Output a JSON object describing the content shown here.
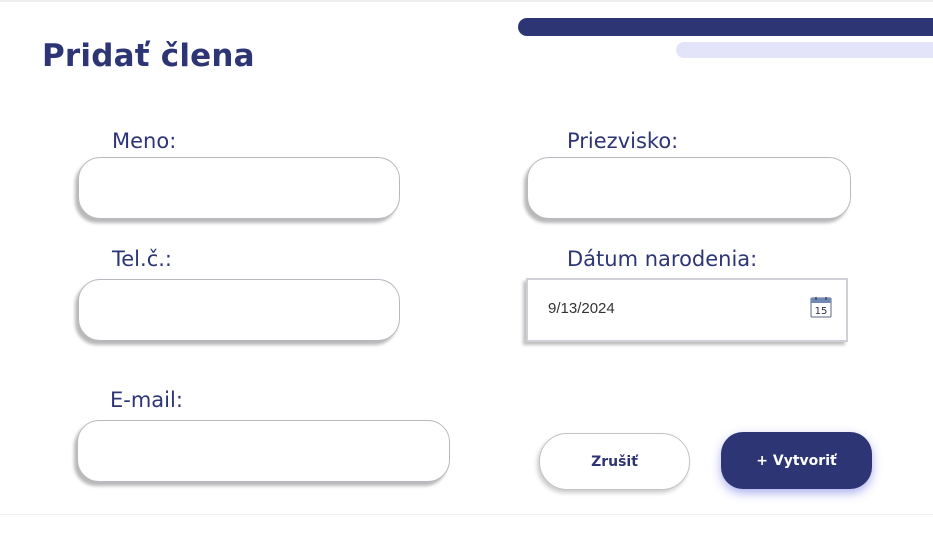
{
  "page": {
    "title": "Pridať člena"
  },
  "form": {
    "first_name": {
      "label": "Meno:",
      "value": ""
    },
    "last_name": {
      "label": "Priezvisko:",
      "value": ""
    },
    "phone": {
      "label": "Tel.č.:",
      "value": ""
    },
    "birth_date": {
      "label": "Dátum narodenia:",
      "value": "9/13/2024",
      "icon_day": "15"
    },
    "email": {
      "label": "E-mail:",
      "value": ""
    }
  },
  "buttons": {
    "cancel": "Zrušiť",
    "create": "+ Vytvoriť"
  },
  "colors": {
    "primary": "#2e3575",
    "accent_light": "#e3e3fa"
  },
  "icons": {
    "date_picker": "calendar-icon"
  }
}
